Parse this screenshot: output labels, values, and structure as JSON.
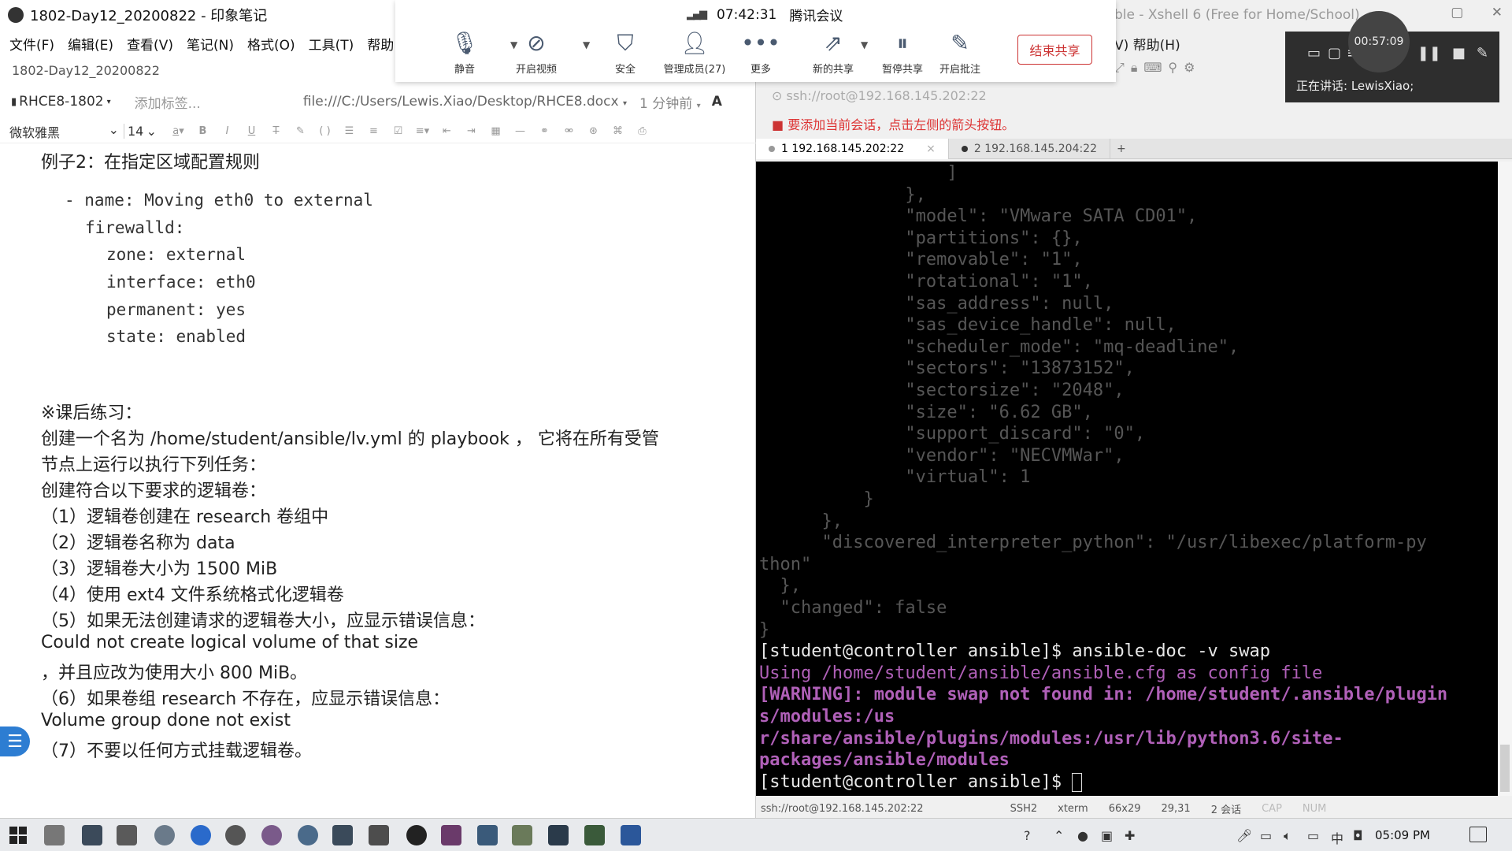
{
  "evernote": {
    "window_title": "1802-Day12_20200822 - 印象笔记",
    "menu": [
      "文件(F)",
      "编辑(E)",
      "查看(V)",
      "笔记(N)",
      "格式(O)",
      "工具(T)",
      "帮助"
    ],
    "note_title": "1802-Day12_20200822",
    "notebook": "RHCE8-1802",
    "add_tag": "添加标签...",
    "file_path": "file:///C:/Users/Lewis.Xiao/Desktop/RHCE8.docx",
    "updated": "1 分钟前",
    "font_name": "微软雅黑",
    "font_size": "14",
    "content": {
      "heading": "例子2：在指定区域配置规则",
      "code": [
        "- name: Moving eth0 to external",
        "firewalld:",
        "zone: external",
        "interface: eth0",
        "permanent: yes",
        "state: enabled"
      ],
      "lines": [
        "※课后练习：",
        "创建一个名为 /home/student/ansible/lv.yml 的 playbook ， 它将在所有受管",
        "节点上运行以执行下列任务：",
        "创建符合以下要求的逻辑卷：",
        "（1）逻辑卷创建在 research 卷组中",
        "（2）逻辑卷名称为 data",
        "（3）逻辑卷大小为 1500 MiB",
        "（4）使用 ext4 文件系统格式化逻辑卷",
        "（5）如果无法创建请求的逻辑卷大小，应显示错误信息：",
        "Could not create logical volume of that size",
        "，并且应改为使用大小 800 MiB。",
        "（6）如果卷组 research 不存在，应显示错误信息：",
        "Volume group done not exist",
        "（7）不要以任何方式挂载逻辑卷。"
      ]
    }
  },
  "meeting": {
    "time": "07:42:31",
    "title": "腾讯会议",
    "buttons": [
      "静音",
      "开启视频",
      "安全",
      "管理成员(27)",
      "更多",
      "新的共享",
      "暂停共享",
      "开启批注"
    ],
    "end_share": "结束共享"
  },
  "xshell": {
    "window_title": "ble - Xshell 6 (Free for Home/School)",
    "menu": "V)  帮助(H)",
    "address": "ssh://root@192.168.145.202:22",
    "hint": "要添加当前会话，点击左侧的箭头按钮。",
    "tabs": [
      "1 192.168.145.202:22",
      "2 192.168.145.204:22"
    ],
    "terminal_lines": [
      {
        "text": "                  ]",
        "cls": "t-dim"
      },
      {
        "text": "              },",
        "cls": "t-dim"
      },
      {
        "text": "              \"model\": \"VMware SATA CD01\",",
        "cls": "t-dim"
      },
      {
        "text": "              \"partitions\": {},",
        "cls": "t-dim"
      },
      {
        "text": "              \"removable\": \"1\",",
        "cls": "t-dim"
      },
      {
        "text": "              \"rotational\": \"1\",",
        "cls": "t-dim"
      },
      {
        "text": "              \"sas_address\": null,",
        "cls": "t-dim"
      },
      {
        "text": "              \"sas_device_handle\": null,",
        "cls": "t-dim"
      },
      {
        "text": "              \"scheduler_mode\": \"mq-deadline\",",
        "cls": "t-dim"
      },
      {
        "text": "              \"sectors\": \"13873152\",",
        "cls": "t-dim"
      },
      {
        "text": "              \"sectorsize\": \"2048\",",
        "cls": "t-dim"
      },
      {
        "text": "              \"size\": \"6.62 GB\",",
        "cls": "t-dim"
      },
      {
        "text": "              \"support_discard\": \"0\",",
        "cls": "t-dim"
      },
      {
        "text": "              \"vendor\": \"NECVMWar\",",
        "cls": "t-dim"
      },
      {
        "text": "              \"virtual\": 1",
        "cls": "t-dim"
      },
      {
        "text": "          }",
        "cls": "t-dim"
      },
      {
        "text": "      },",
        "cls": "t-dim"
      },
      {
        "text": "      \"discovered_interpreter_python\": \"/usr/libexec/platform-py",
        "cls": "t-dim"
      },
      {
        "text": "thon\"",
        "cls": "t-dim"
      },
      {
        "text": "  },",
        "cls": "t-dim"
      },
      {
        "text": "  \"changed\": false",
        "cls": "t-dim"
      },
      {
        "text": "}",
        "cls": "t-dim"
      },
      {
        "text": "[student@controller ansible]$ ansible-doc -v swap",
        "cls": "t-fg"
      },
      {
        "text": "Using /home/student/ansible/ansible.cfg as config file",
        "cls": "t-purple"
      },
      {
        "text": "[WARNING]: module swap not found in: /home/student/.ansible/plugin",
        "cls": "t-purple-b"
      },
      {
        "text": "s/modules:/us",
        "cls": "t-purple-b"
      },
      {
        "text": "r/share/ansible/plugins/modules:/usr/lib/python3.6/site-",
        "cls": "t-purple-b"
      },
      {
        "text": "packages/ansible/modules",
        "cls": "t-purple-b"
      },
      {
        "text": "[student@controller ansible]$ ",
        "cls": "t-fg"
      }
    ],
    "status": [
      "ssh://root@192.168.145.202:22",
      "SSH2",
      "xterm",
      "66x29",
      "29,31",
      "2 会话",
      "CAP",
      "NUM"
    ]
  },
  "recording": {
    "timer": "00:57:09",
    "speaking": "正在讲话: LewisXiao;"
  },
  "taskbar": {
    "clock": "05:09 PM"
  }
}
